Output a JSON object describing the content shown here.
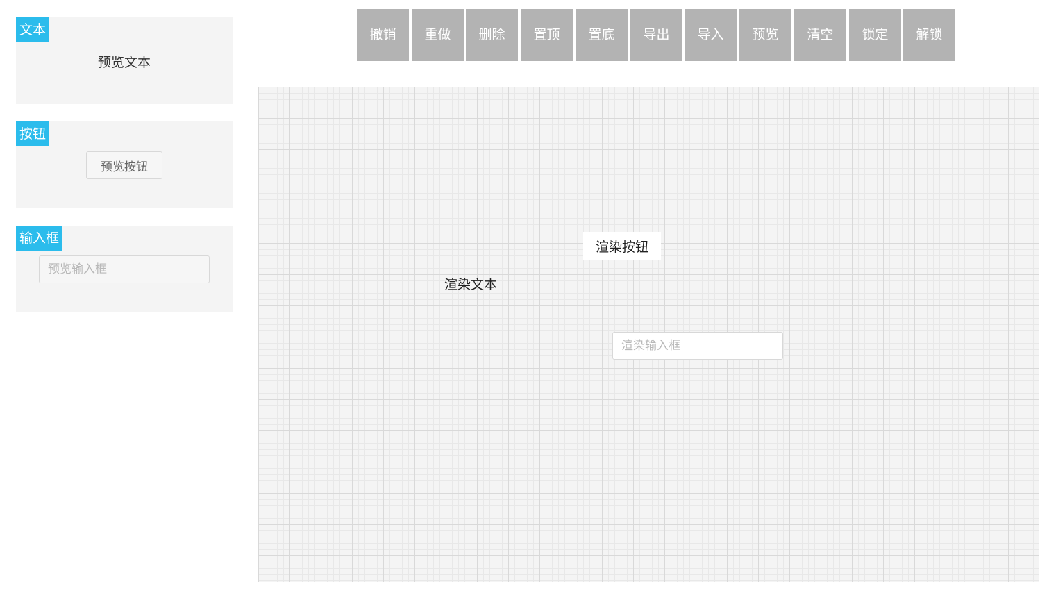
{
  "palette": {
    "text": {
      "tag": "文本",
      "preview": "预览文本"
    },
    "button": {
      "tag": "按钮",
      "preview": "预览按钮"
    },
    "input": {
      "tag": "输入框",
      "placeholder": "预览输入框"
    }
  },
  "toolbar": {
    "undo": "撤销",
    "redo": "重做",
    "delete": "删除",
    "bring_to_top": "置顶",
    "send_to_bottom": "置底",
    "export": "导出",
    "import": "导入",
    "preview": "预览",
    "clear": "清空",
    "lock": "锁定",
    "unlock": "解锁"
  },
  "canvas": {
    "text": "渲染文本",
    "button": "渲染按钮",
    "input_placeholder": "渲染输入框"
  },
  "colors": {
    "tag_accent": "#2bbcec",
    "toolbar_button": "#b3b3b3",
    "canvas_background": "#f4f4f4"
  }
}
